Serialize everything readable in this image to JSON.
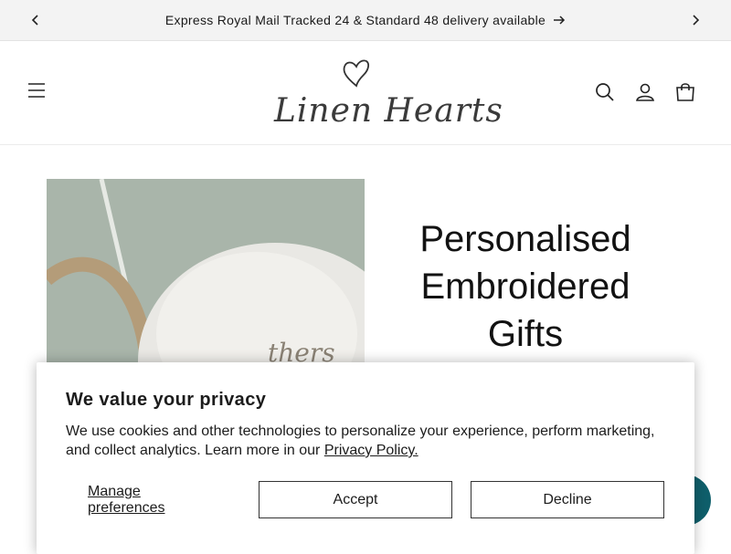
{
  "announcement": {
    "text": "Express Royal Mail Tracked 24 & Standard 48 delivery available",
    "prev_icon": "chevron-left-icon",
    "next_icon": "chevron-right-icon",
    "arrow_icon": "arrow-right-icon"
  },
  "header": {
    "brand": "Linen Hearts",
    "icons": [
      "menu-icon",
      "search-icon",
      "account-icon",
      "cart-icon"
    ]
  },
  "hero": {
    "title_lines": [
      "Personalised",
      "Embroidered",
      "Gifts"
    ],
    "image_text": "thers"
  },
  "cookie": {
    "title": "We value your privacy",
    "body": "We use cookies and other technologies to personalize your experience, perform marketing, and collect analytics. Learn more in our ",
    "link": "Privacy Policy.",
    "manage_label": "Manage preferences",
    "accept_label": "Accept",
    "decline_label": "Decline"
  },
  "colors": {
    "announce_bg": "#f3f3f3",
    "chat_accent": "#0f5f6b"
  }
}
